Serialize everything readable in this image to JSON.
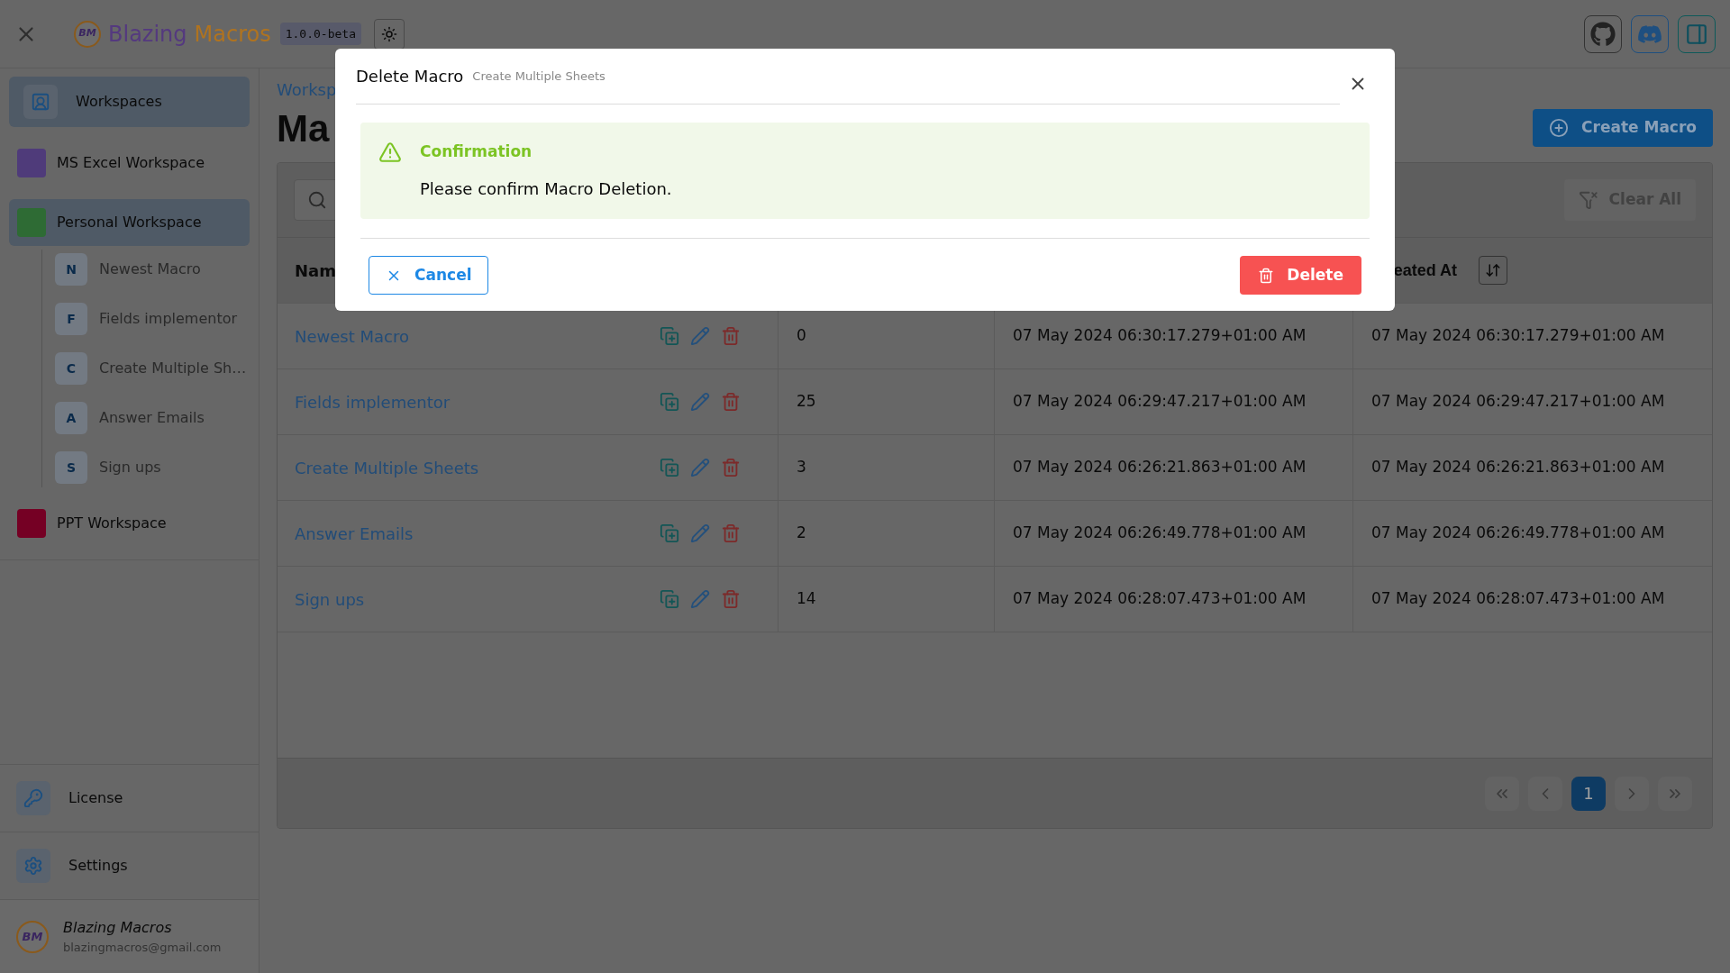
{
  "app": {
    "logo_mark": "BM",
    "title_parts": [
      {
        "text": "Blazing",
        "color": "#54397f"
      },
      {
        "text": "Macros",
        "color": "#b0731f"
      }
    ],
    "version": "1.0.0-beta"
  },
  "sidebar": {
    "items": [
      {
        "kind": "nav",
        "label": "Workspaces",
        "selected": true
      },
      {
        "kind": "workspace",
        "label": "MS Excel Workspace",
        "color": "#4f3b7a",
        "selected": false
      },
      {
        "kind": "workspace",
        "label": "Personal Workspace",
        "color": "#2e6b34",
        "selected": true,
        "children": [
          {
            "initial": "N",
            "label": "Newest Macro"
          },
          {
            "initial": "F",
            "label": "Fields implementor"
          },
          {
            "initial": "C",
            "label": "Create Multiple Sh…"
          },
          {
            "initial": "A",
            "label": "Answer Emails"
          },
          {
            "initial": "S",
            "label": "Sign ups"
          }
        ]
      },
      {
        "kind": "workspace",
        "label": "PPT Workspace",
        "color": "#750024",
        "selected": false
      }
    ],
    "bottom": [
      {
        "kind": "license",
        "label": "License"
      },
      {
        "kind": "settings",
        "label": "Settings"
      }
    ],
    "user": {
      "avatar_mark": "BM",
      "name": "Blazing Macros",
      "email": "blazingmacros@gmail.com"
    }
  },
  "main": {
    "breadcrumb": "Worksp",
    "title": "Ma",
    "create_button": "Create Macro",
    "clear_button": "Clear All",
    "table": {
      "header_left": "Nam",
      "header_right": "eated At",
      "rows": [
        {
          "name": "Newest Macro",
          "column_2": "0",
          "column_3": "07 May 2024 06:30:17.279+01:00 AM",
          "column_4": "07 May 2024 06:30:17.279+01:00 AM"
        },
        {
          "name": "Fields implementor",
          "column_2": "25",
          "column_3": "07 May 2024 06:29:47.217+01:00 AM",
          "column_4": "07 May 2024 06:29:47.217+01:00 AM"
        },
        {
          "name": "Create Multiple Sheets",
          "column_2": "3",
          "column_3": "07 May 2024 06:26:21.863+01:00 AM",
          "column_4": "07 May 2024 06:26:21.863+01:00 AM"
        },
        {
          "name": "Answer Emails",
          "column_2": "2",
          "column_3": "07 May 2024 06:26:49.778+01:00 AM",
          "column_4": "07 May 2024 06:26:49.778+01:00 AM"
        },
        {
          "name": "Sign ups",
          "column_2": "14",
          "column_3": "07 May 2024 06:28:07.473+01:00 AM",
          "column_4": "07 May 2024 06:28:07.473+01:00 AM"
        }
      ]
    },
    "pagination": {
      "pages": [
        {
          "label": "1",
          "selected": true
        }
      ]
    }
  },
  "dialog": {
    "title": "Delete Macro",
    "subtitle": "Create Multiple Sheets",
    "alert_title": "Confirmation",
    "message": "Please confirm Macro Deletion.",
    "cancel": "Cancel",
    "confirm": "Delete"
  }
}
